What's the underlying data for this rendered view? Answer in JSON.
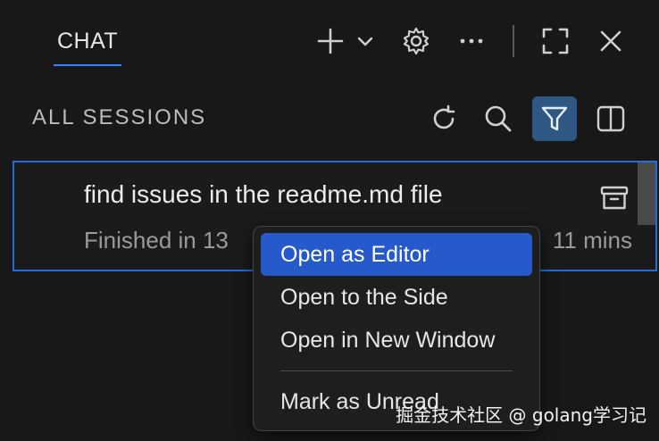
{
  "header": {
    "tab_label": "CHAT"
  },
  "sessions": {
    "title": "ALL SESSIONS",
    "item": {
      "title": "find issues in the readme.md file",
      "status_visible": "Finished in 13",
      "time_visible": "11 mins"
    }
  },
  "context_menu": {
    "items": [
      {
        "label": "Open as Editor"
      },
      {
        "label": "Open to the Side"
      },
      {
        "label": "Open in New Window"
      },
      {
        "label": "Mark as Unread"
      }
    ]
  },
  "watermark": "掘金技术社区 @ golang学习记",
  "colors": {
    "background": "#181818",
    "accent": "#2d6ad0",
    "menu_highlight": "#2659c9",
    "filter_active": "#2f5783"
  },
  "icons": {
    "header": [
      "plus-icon",
      "chevron-down-icon",
      "gear-icon",
      "ellipsis-icon",
      "maximize-icon",
      "close-icon"
    ],
    "sessions_toolbar": [
      "refresh-icon",
      "search-icon",
      "filter-icon",
      "split-panel-icon"
    ],
    "session_row": [
      "archive-icon"
    ]
  }
}
